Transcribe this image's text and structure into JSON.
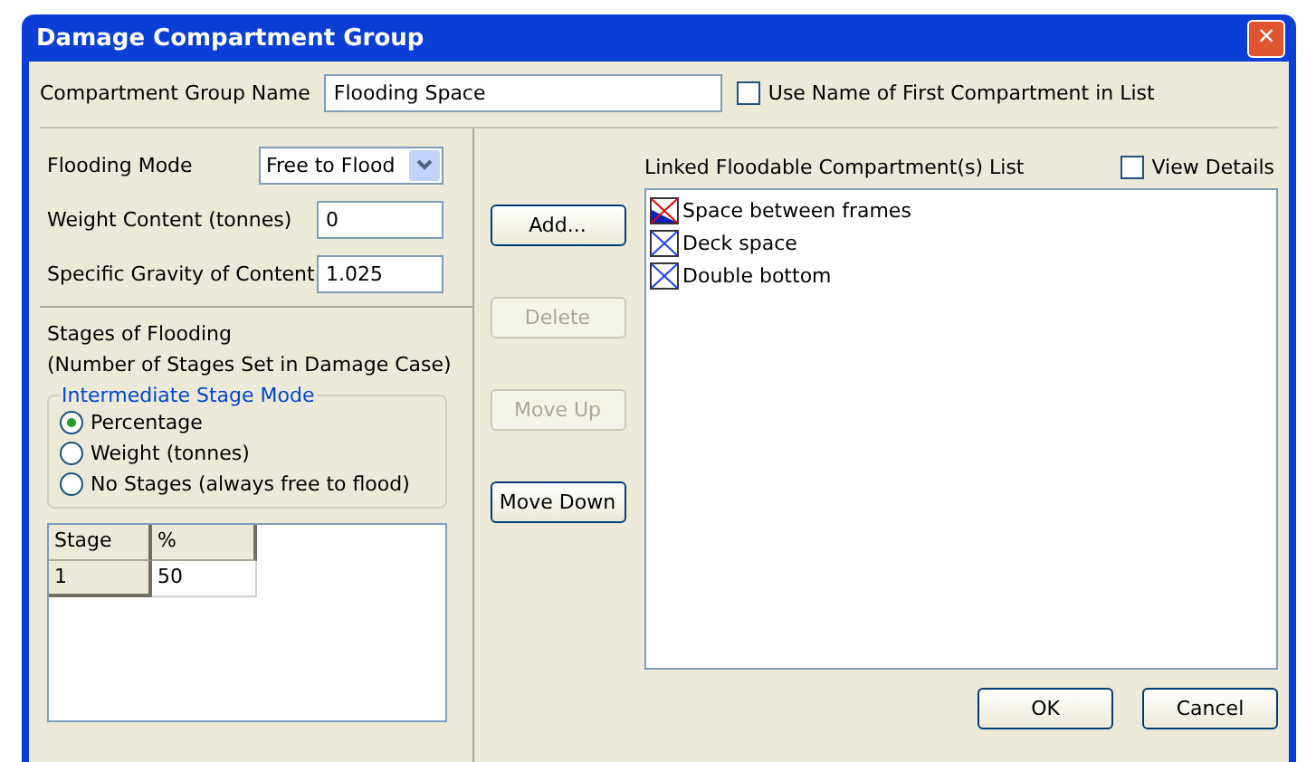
{
  "window": {
    "title": "Damage Compartment Group",
    "close": "×"
  },
  "group_name": {
    "label": "Compartment Group Name",
    "value": "Flooding Space"
  },
  "use_first_name": {
    "label": "Use Name of First Compartment in List",
    "checked": false
  },
  "flooding_mode": {
    "label": "Flooding Mode",
    "value": "Free to Flood"
  },
  "weight_content": {
    "label": "Weight Content (tonnes)",
    "value": "0"
  },
  "specific_gravity": {
    "label": "Specific Gravity of Content",
    "value": "1.025"
  },
  "stages": {
    "title": "Stages of Flooding",
    "note": "(Number of Stages Set in Damage Case)"
  },
  "stage_mode": {
    "legend": "Intermediate Stage Mode",
    "options": [
      {
        "label": "Percentage",
        "selected": true
      },
      {
        "label": "Weight (tonnes)",
        "selected": false
      },
      {
        "label": "No Stages (always free to flood)",
        "selected": false
      }
    ]
  },
  "stage_table": {
    "columns": [
      "Stage",
      "%"
    ],
    "rows": [
      [
        "1",
        "50"
      ]
    ]
  },
  "buttons": [
    {
      "label": "Add...",
      "disabled": false
    },
    {
      "label": "Delete",
      "disabled": true
    },
    {
      "label": "Move Up",
      "disabled": true
    },
    {
      "label": "Move Down",
      "disabled": false
    }
  ],
  "compartments": {
    "label": "Linked Floodable Compartment(s) List",
    "view_details": {
      "label": "View Details",
      "checked": false
    },
    "items": [
      {
        "name": "Space between frames",
        "kind": "flooded"
      },
      {
        "name": "Deck space",
        "kind": "empty"
      },
      {
        "name": "Double bottom",
        "kind": "empty"
      }
    ]
  },
  "footer": [
    "OK",
    "Cancel"
  ]
}
